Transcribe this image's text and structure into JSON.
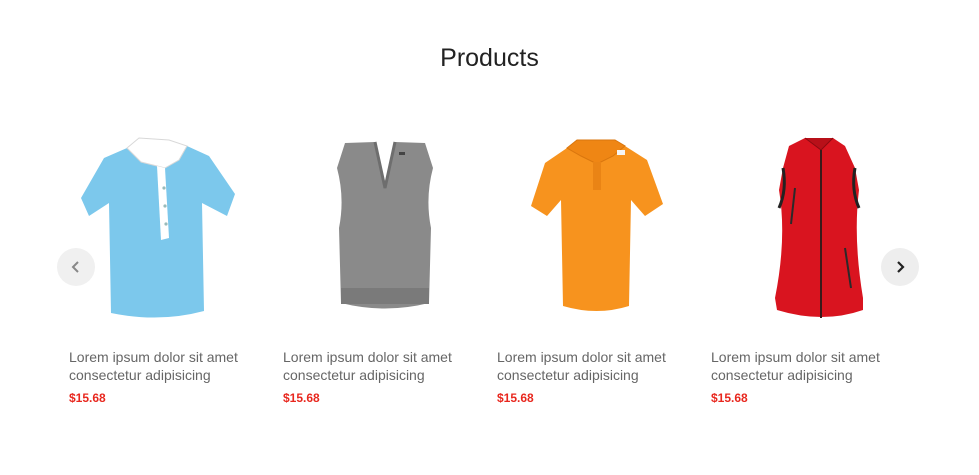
{
  "section": {
    "title": "Products"
  },
  "nav": {
    "prev_icon": "chevron-left-icon",
    "next_icon": "chevron-right-icon"
  },
  "products": [
    {
      "title": "Lorem ipsum dolor sit amet consectetur adipisicing",
      "price": "$15.68",
      "image": "light-blue-polo-shirt",
      "color": "#7cc8ec"
    },
    {
      "title": "Lorem ipsum dolor sit amet consectetur adipisicing",
      "price": "$15.68",
      "image": "grey-knit-vest",
      "color": "#8a8a8a"
    },
    {
      "title": "Lorem ipsum dolor sit amet consectetur adipisicing",
      "price": "$15.68",
      "image": "orange-polo-shirt",
      "color": "#f7931e"
    },
    {
      "title": "Lorem ipsum dolor sit amet consectetur adipisicing",
      "price": "$15.68",
      "image": "red-softshell-vest",
      "color": "#d9141f"
    }
  ],
  "colors": {
    "price": "#e8271e",
    "text": "#666666",
    "title": "#222222"
  }
}
